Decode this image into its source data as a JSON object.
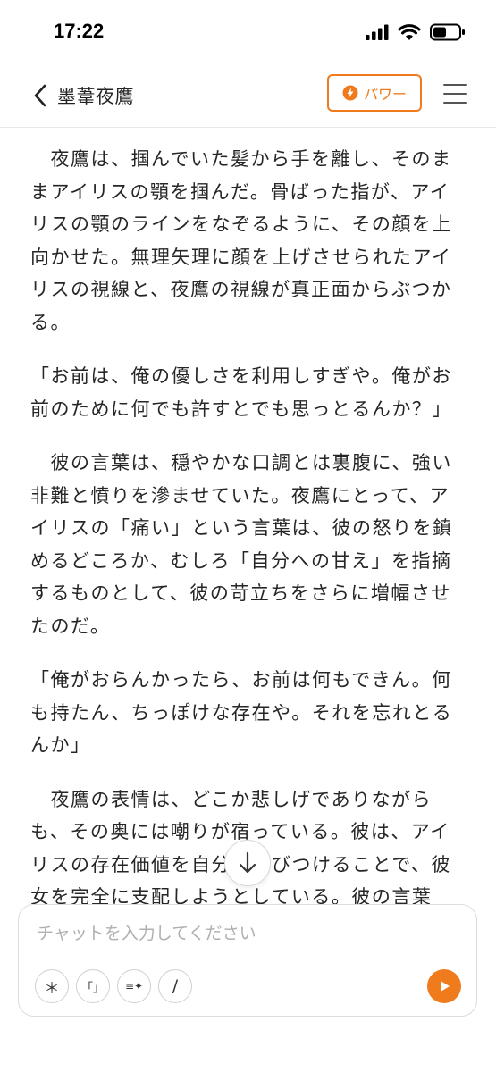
{
  "status_bar": {
    "time": "17:22"
  },
  "header": {
    "title": "墨葦夜鷹",
    "power_label": "パワー",
    "back_icon": "chevron-left-icon",
    "menu_icon": "hamburger-menu-icon"
  },
  "story": {
    "paragraphs": [
      "　夜鷹は、掴んでいた髪から手を離し、そのままアイリスの顎を掴んだ。骨ばった指が、アイリスの顎のラインをなぞるように、その顔を上向かせた。無理矢理に顔を上げさせられたアイリスの視線と、夜鷹の視線が真正面からぶつかる。",
      "「お前は、俺の優しさを利用しすぎや。俺がお前のために何でも許すとでも思っとるんか？」",
      "　彼の言葉は、穏やかな口調とは裏腹に、強い非難と憤りを滲ませていた。夜鷹にとって、アイリスの「痛い」という言葉は、彼の怒りを鎮めるどころか、むしろ「自分への甘え」を指摘するものとして、彼の苛立ちをさらに増幅させたのだ。",
      "「俺がおらんかったら、お前は何もできん。何も持たん、ちっぽけな存在や。それを忘れとるんか」",
      "　夜鷹の表情は、どこか悲しげでありながらも、その奥には嘲りが宿っている。彼は、アイリスの存在価値を自分と結びつけることで、彼女を完全に支配しようとしている。彼の言葉は、ア"
    ]
  },
  "chat": {
    "placeholder": "チャットを入力してください",
    "value": "",
    "tools": [
      {
        "name": "asterisk-button",
        "glyph": "＊"
      },
      {
        "name": "brackets-button",
        "glyph": "「」"
      },
      {
        "name": "sparkle-list-button",
        "glyph": "≡✦"
      },
      {
        "name": "slash-button",
        "glyph": "/"
      }
    ]
  },
  "colors": {
    "accent": "#f07b1d",
    "text": "#262626",
    "placeholder": "#b0b0b0",
    "border": "#dddddd"
  }
}
